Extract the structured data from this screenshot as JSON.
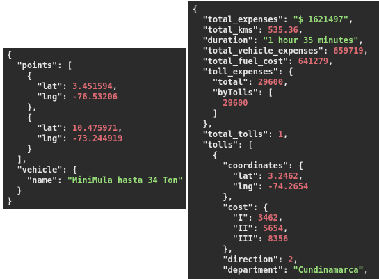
{
  "left_panel": {
    "lines": [
      [
        {
          "t": "p",
          "v": "{"
        }
      ],
      [
        {
          "t": "p",
          "v": "  "
        },
        {
          "t": "k",
          "v": "\"points\""
        },
        {
          "t": "p",
          "v": ": ["
        }
      ],
      [
        {
          "t": "p",
          "v": "    {"
        }
      ],
      [
        {
          "t": "p",
          "v": "      "
        },
        {
          "t": "k",
          "v": "\"lat\""
        },
        {
          "t": "p",
          "v": ": "
        },
        {
          "t": "n",
          "v": "3.451594"
        },
        {
          "t": "p",
          "v": ","
        }
      ],
      [
        {
          "t": "p",
          "v": "      "
        },
        {
          "t": "k",
          "v": "\"lng\""
        },
        {
          "t": "p",
          "v": ": "
        },
        {
          "t": "n",
          "v": "-76.53206"
        }
      ],
      [
        {
          "t": "p",
          "v": "    },"
        }
      ],
      [
        {
          "t": "p",
          "v": "    {"
        }
      ],
      [
        {
          "t": "p",
          "v": "      "
        },
        {
          "t": "k",
          "v": "\"lat\""
        },
        {
          "t": "p",
          "v": ": "
        },
        {
          "t": "n",
          "v": "10.475971"
        },
        {
          "t": "p",
          "v": ","
        }
      ],
      [
        {
          "t": "p",
          "v": "      "
        },
        {
          "t": "k",
          "v": "\"lng\""
        },
        {
          "t": "p",
          "v": ": "
        },
        {
          "t": "n",
          "v": "-73.244919"
        }
      ],
      [
        {
          "t": "p",
          "v": "    }"
        }
      ],
      [
        {
          "t": "p",
          "v": "  ],"
        }
      ],
      [
        {
          "t": "p",
          "v": "  "
        },
        {
          "t": "k",
          "v": "\"vehicle\""
        },
        {
          "t": "p",
          "v": ": {"
        }
      ],
      [
        {
          "t": "p",
          "v": "    "
        },
        {
          "t": "k",
          "v": "\"name\""
        },
        {
          "t": "p",
          "v": ": "
        },
        {
          "t": "s",
          "v": "\"MiniMula hasta 34 Ton\""
        }
      ],
      [
        {
          "t": "p",
          "v": "  }"
        }
      ],
      [
        {
          "t": "p",
          "v": "}"
        }
      ]
    ]
  },
  "right_panel": {
    "lines": [
      [
        {
          "t": "p",
          "v": "{"
        }
      ],
      [
        {
          "t": "p",
          "v": "  "
        },
        {
          "t": "k",
          "v": "\"total_expenses\""
        },
        {
          "t": "p",
          "v": ": "
        },
        {
          "t": "s",
          "v": "\"$ 1621497\""
        },
        {
          "t": "p",
          "v": ","
        }
      ],
      [
        {
          "t": "p",
          "v": "  "
        },
        {
          "t": "k",
          "v": "\"total_kms\""
        },
        {
          "t": "p",
          "v": ": "
        },
        {
          "t": "n",
          "v": "535.36"
        },
        {
          "t": "p",
          "v": ","
        }
      ],
      [
        {
          "t": "p",
          "v": "  "
        },
        {
          "t": "k",
          "v": "\"duration\""
        },
        {
          "t": "p",
          "v": ": "
        },
        {
          "t": "s",
          "v": "\"1 hour 35 minutes\""
        },
        {
          "t": "p",
          "v": ","
        }
      ],
      [
        {
          "t": "p",
          "v": "  "
        },
        {
          "t": "k",
          "v": "\"total_vehicle_expenses\""
        },
        {
          "t": "p",
          "v": ": "
        },
        {
          "t": "n",
          "v": "659719"
        },
        {
          "t": "p",
          "v": ","
        }
      ],
      [
        {
          "t": "p",
          "v": "  "
        },
        {
          "t": "k",
          "v": "\"total_fuel_cost\""
        },
        {
          "t": "p",
          "v": ": "
        },
        {
          "t": "n",
          "v": "641279"
        },
        {
          "t": "p",
          "v": ","
        }
      ],
      [
        {
          "t": "p",
          "v": "  "
        },
        {
          "t": "k",
          "v": "\"toll_expenses\""
        },
        {
          "t": "p",
          "v": ": {"
        }
      ],
      [
        {
          "t": "p",
          "v": "    "
        },
        {
          "t": "k",
          "v": "\"total\""
        },
        {
          "t": "p",
          "v": ": "
        },
        {
          "t": "n",
          "v": "29600"
        },
        {
          "t": "p",
          "v": ","
        }
      ],
      [
        {
          "t": "p",
          "v": "    "
        },
        {
          "t": "k",
          "v": "\"byTolls\""
        },
        {
          "t": "p",
          "v": ": ["
        }
      ],
      [
        {
          "t": "p",
          "v": "      "
        },
        {
          "t": "n",
          "v": "29600"
        }
      ],
      [
        {
          "t": "p",
          "v": "    ]"
        }
      ],
      [
        {
          "t": "p",
          "v": "  },"
        }
      ],
      [
        {
          "t": "p",
          "v": "  "
        },
        {
          "t": "k",
          "v": "\"total_tolls\""
        },
        {
          "t": "p",
          "v": ": "
        },
        {
          "t": "n",
          "v": "1"
        },
        {
          "t": "p",
          "v": ","
        }
      ],
      [
        {
          "t": "p",
          "v": "  "
        },
        {
          "t": "k",
          "v": "\"tolls\""
        },
        {
          "t": "p",
          "v": ": ["
        }
      ],
      [
        {
          "t": "p",
          "v": "    {"
        }
      ],
      [
        {
          "t": "p",
          "v": "      "
        },
        {
          "t": "k",
          "v": "\"coordinates\""
        },
        {
          "t": "p",
          "v": ": {"
        }
      ],
      [
        {
          "t": "p",
          "v": "        "
        },
        {
          "t": "k",
          "v": "\"lat\""
        },
        {
          "t": "p",
          "v": ": "
        },
        {
          "t": "n",
          "v": "3.2462"
        },
        {
          "t": "p",
          "v": ","
        }
      ],
      [
        {
          "t": "p",
          "v": "        "
        },
        {
          "t": "k",
          "v": "\"lng\""
        },
        {
          "t": "p",
          "v": ": "
        },
        {
          "t": "n",
          "v": "-74.2654"
        }
      ],
      [
        {
          "t": "p",
          "v": "      },"
        }
      ],
      [
        {
          "t": "p",
          "v": "      "
        },
        {
          "t": "k",
          "v": "\"cost\""
        },
        {
          "t": "p",
          "v": ": {"
        }
      ],
      [
        {
          "t": "p",
          "v": "        "
        },
        {
          "t": "k",
          "v": "\"I\""
        },
        {
          "t": "p",
          "v": ": "
        },
        {
          "t": "n",
          "v": "3462"
        },
        {
          "t": "p",
          "v": ","
        }
      ],
      [
        {
          "t": "p",
          "v": "        "
        },
        {
          "t": "k",
          "v": "\"II\""
        },
        {
          "t": "p",
          "v": ": "
        },
        {
          "t": "n",
          "v": "5654"
        },
        {
          "t": "p",
          "v": ","
        }
      ],
      [
        {
          "t": "p",
          "v": "        "
        },
        {
          "t": "k",
          "v": "\"III\""
        },
        {
          "t": "p",
          "v": ": "
        },
        {
          "t": "n",
          "v": "8356"
        }
      ],
      [
        {
          "t": "p",
          "v": "      },"
        }
      ],
      [
        {
          "t": "p",
          "v": "      "
        },
        {
          "t": "k",
          "v": "\"direction\""
        },
        {
          "t": "p",
          "v": ": "
        },
        {
          "t": "n",
          "v": "2"
        },
        {
          "t": "p",
          "v": ","
        }
      ],
      [
        {
          "t": "p",
          "v": "      "
        },
        {
          "t": "k",
          "v": "\"department\""
        },
        {
          "t": "p",
          "v": ": "
        },
        {
          "t": "s",
          "v": "\"Cundinamarca\""
        },
        {
          "t": "p",
          "v": ","
        }
      ]
    ]
  },
  "colors": {
    "background": "#2b2b2b",
    "punctuation": "#e6e6e6",
    "key": "#e6e6e6",
    "number": "#e06c75",
    "string": "#98e07a"
  }
}
